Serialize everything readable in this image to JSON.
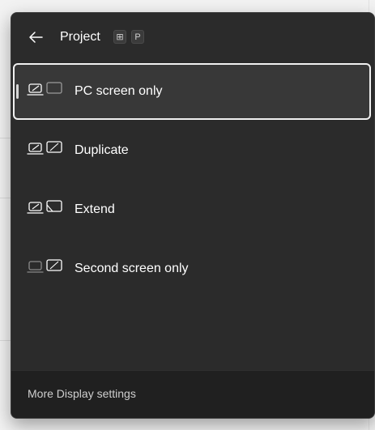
{
  "header": {
    "title": "Project",
    "back_icon": "arrow-left-icon",
    "shortcut_keys": [
      "⊞",
      "P"
    ]
  },
  "options": [
    {
      "label": "PC screen only",
      "icon": "pc-screen-only-icon",
      "selected": true
    },
    {
      "label": "Duplicate",
      "icon": "duplicate-icon",
      "selected": false
    },
    {
      "label": "Extend",
      "icon": "extend-icon",
      "selected": false
    },
    {
      "label": "Second screen only",
      "icon": "second-screen-only-icon",
      "selected": false
    }
  ],
  "footer": {
    "link_label": "More Display settings"
  },
  "colors": {
    "flyout_bg": "#2b2b2b",
    "footer_bg": "#202020",
    "selected_bg": "#383838",
    "selected_border": "#f0f0f0",
    "text": "#ffffff"
  }
}
